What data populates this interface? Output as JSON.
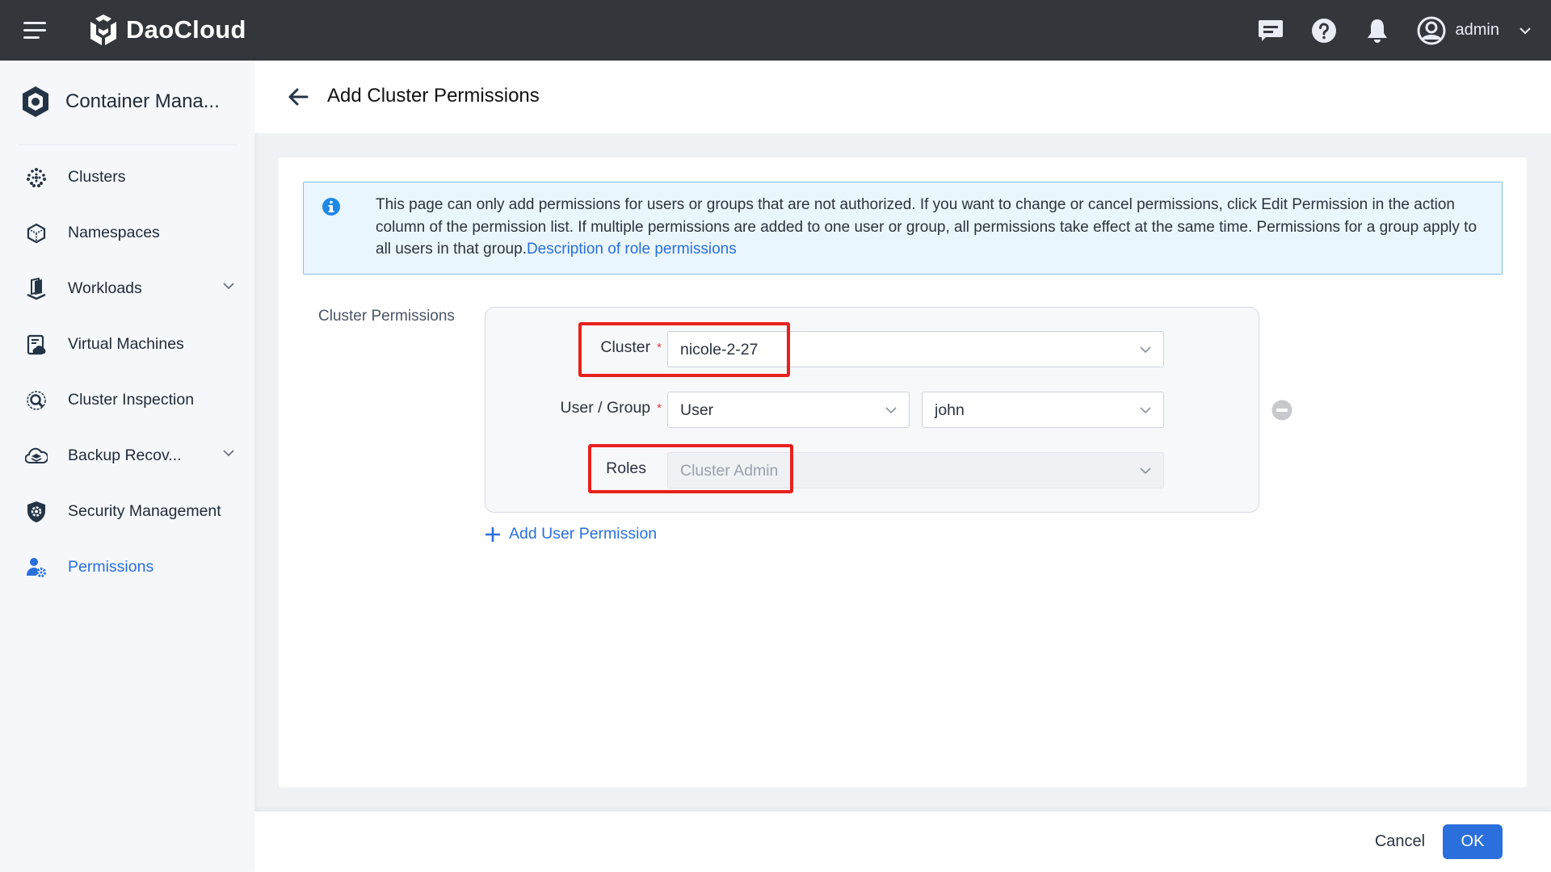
{
  "topbar": {
    "brand": "DaoCloud",
    "icons": [
      "menu-icon",
      "message-icon",
      "help-icon",
      "bell-icon",
      "user-avatar-icon"
    ],
    "user_name": "admin"
  },
  "sidebar": {
    "product_name": "Container Mana...",
    "items": [
      {
        "label": "Clusters",
        "icon": "clusters-icon",
        "expandable": false,
        "active": false
      },
      {
        "label": "Namespaces",
        "icon": "namespace-cube-icon",
        "expandable": false,
        "active": false
      },
      {
        "label": "Workloads",
        "icon": "workloads-icon",
        "expandable": true,
        "active": false
      },
      {
        "label": "Virtual Machines",
        "icon": "virtual-machine-icon",
        "expandable": false,
        "active": false
      },
      {
        "label": "Cluster Inspection",
        "icon": "inspection-icon",
        "expandable": false,
        "active": false
      },
      {
        "label": "Backup Recov...",
        "icon": "backup-cloud-icon",
        "expandable": true,
        "active": false
      },
      {
        "label": "Security Management",
        "icon": "security-shield-icon",
        "expandable": false,
        "active": false
      },
      {
        "label": "Permissions",
        "icon": "permissions-user-gear-icon",
        "expandable": false,
        "active": true
      }
    ]
  },
  "header": {
    "title": "Add Cluster Permissions"
  },
  "alert": {
    "text": "This page can only add permissions for users or groups that are not authorized. If you want to change or cancel permissions, click Edit Permission in the action column of the permission list. If multiple permissions are added to one user or group, all permissions take effect at the same time. Permissions for a group apply to all users in that group.",
    "link": "Description of role permissions"
  },
  "form": {
    "section_label": "Cluster Permissions",
    "cluster": {
      "label": "Cluster",
      "required": true,
      "value": "nicole-2-27"
    },
    "user_group": {
      "label": "User / Group",
      "required": true,
      "type_value": "User",
      "name_value": "john"
    },
    "roles": {
      "label": "Roles",
      "value": "Cluster Admin",
      "disabled": true
    },
    "add_label": "Add User Permission"
  },
  "footer": {
    "cancel_label": "Cancel",
    "ok_label": "OK"
  },
  "colors": {
    "topbar": "#33363b",
    "accent": "#2a6fdb",
    "highlight": "#e8211c",
    "required": "#e53935"
  }
}
